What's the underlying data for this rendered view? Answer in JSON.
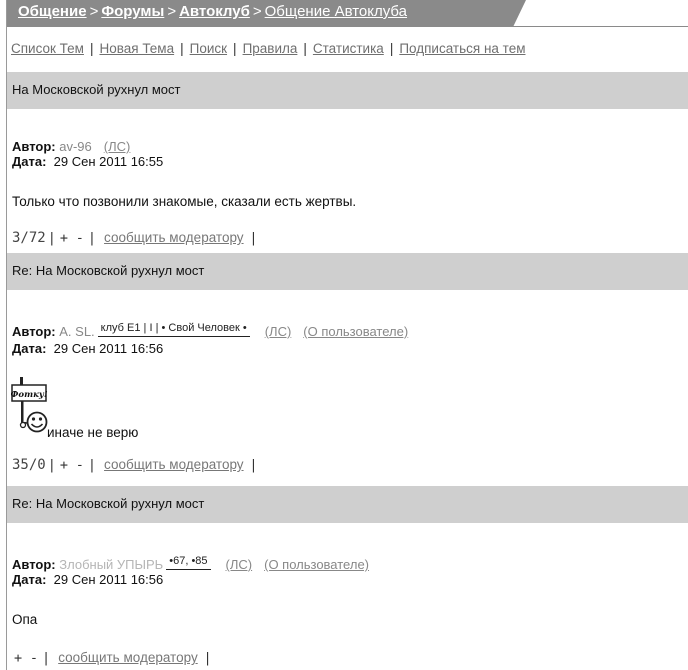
{
  "breadcrumb": {
    "items": [
      {
        "label": "Общение",
        "bold": true
      },
      {
        "label": "Форумы",
        "bold": true
      },
      {
        "label": "Автоклуб",
        "bold": true
      },
      {
        "label": "Общение Автоклуба",
        "bold": false
      }
    ],
    "separator": ">"
  },
  "nav": {
    "items": [
      "Список Тем",
      "Новая Тема",
      "Поиск",
      "Правила",
      "Статистика",
      "Подписаться на тем"
    ],
    "separator": "|"
  },
  "posts": [
    {
      "title": "На Московской рухнул мост",
      "author_label": "Автор:",
      "author": "av-96",
      "pm": "(ЛС)",
      "date_label": "Дата:",
      "date": "29 Сен 2011 16:55",
      "body": "Только что позвонили знакомые, сказали есть жертвы.",
      "score": "3/72",
      "plus": "+",
      "minus": "-",
      "report": "сообщить модератору"
    },
    {
      "title": "Re: На Московской рухнул мост",
      "author_label": "Автор:",
      "author": "A. SL.",
      "badges": [
        "клуб E1",
        "I",
        "• Свой Человек •"
      ],
      "pm": "(ЛС)",
      "profile": "(О пользователе)",
      "date_label": "Дата:",
      "date": "29 Сен 2011 16:56",
      "sign_text": "Фотку!",
      "body": "иначе не верю",
      "score": "35/0",
      "plus": "+",
      "minus": "-",
      "report": "сообщить модератору"
    },
    {
      "title": "Re: На Московской рухнул мост",
      "author_label": "Автор:",
      "author": "Злобный УПЫРЬ",
      "badges": [
        "•67",
        "•85"
      ],
      "pm": "(ЛС)",
      "profile": "(О пользователе)",
      "date_label": "Дата:",
      "date": "29 Сен 2011 16:56",
      "body": "Опа",
      "plus": "+",
      "minus": "-",
      "report": "сообщить модератору"
    }
  ],
  "colors": {
    "breadcrumb_bg": "#8a8a8a",
    "post_header_bg": "#cfcfcf",
    "link_grey": "#777777"
  }
}
